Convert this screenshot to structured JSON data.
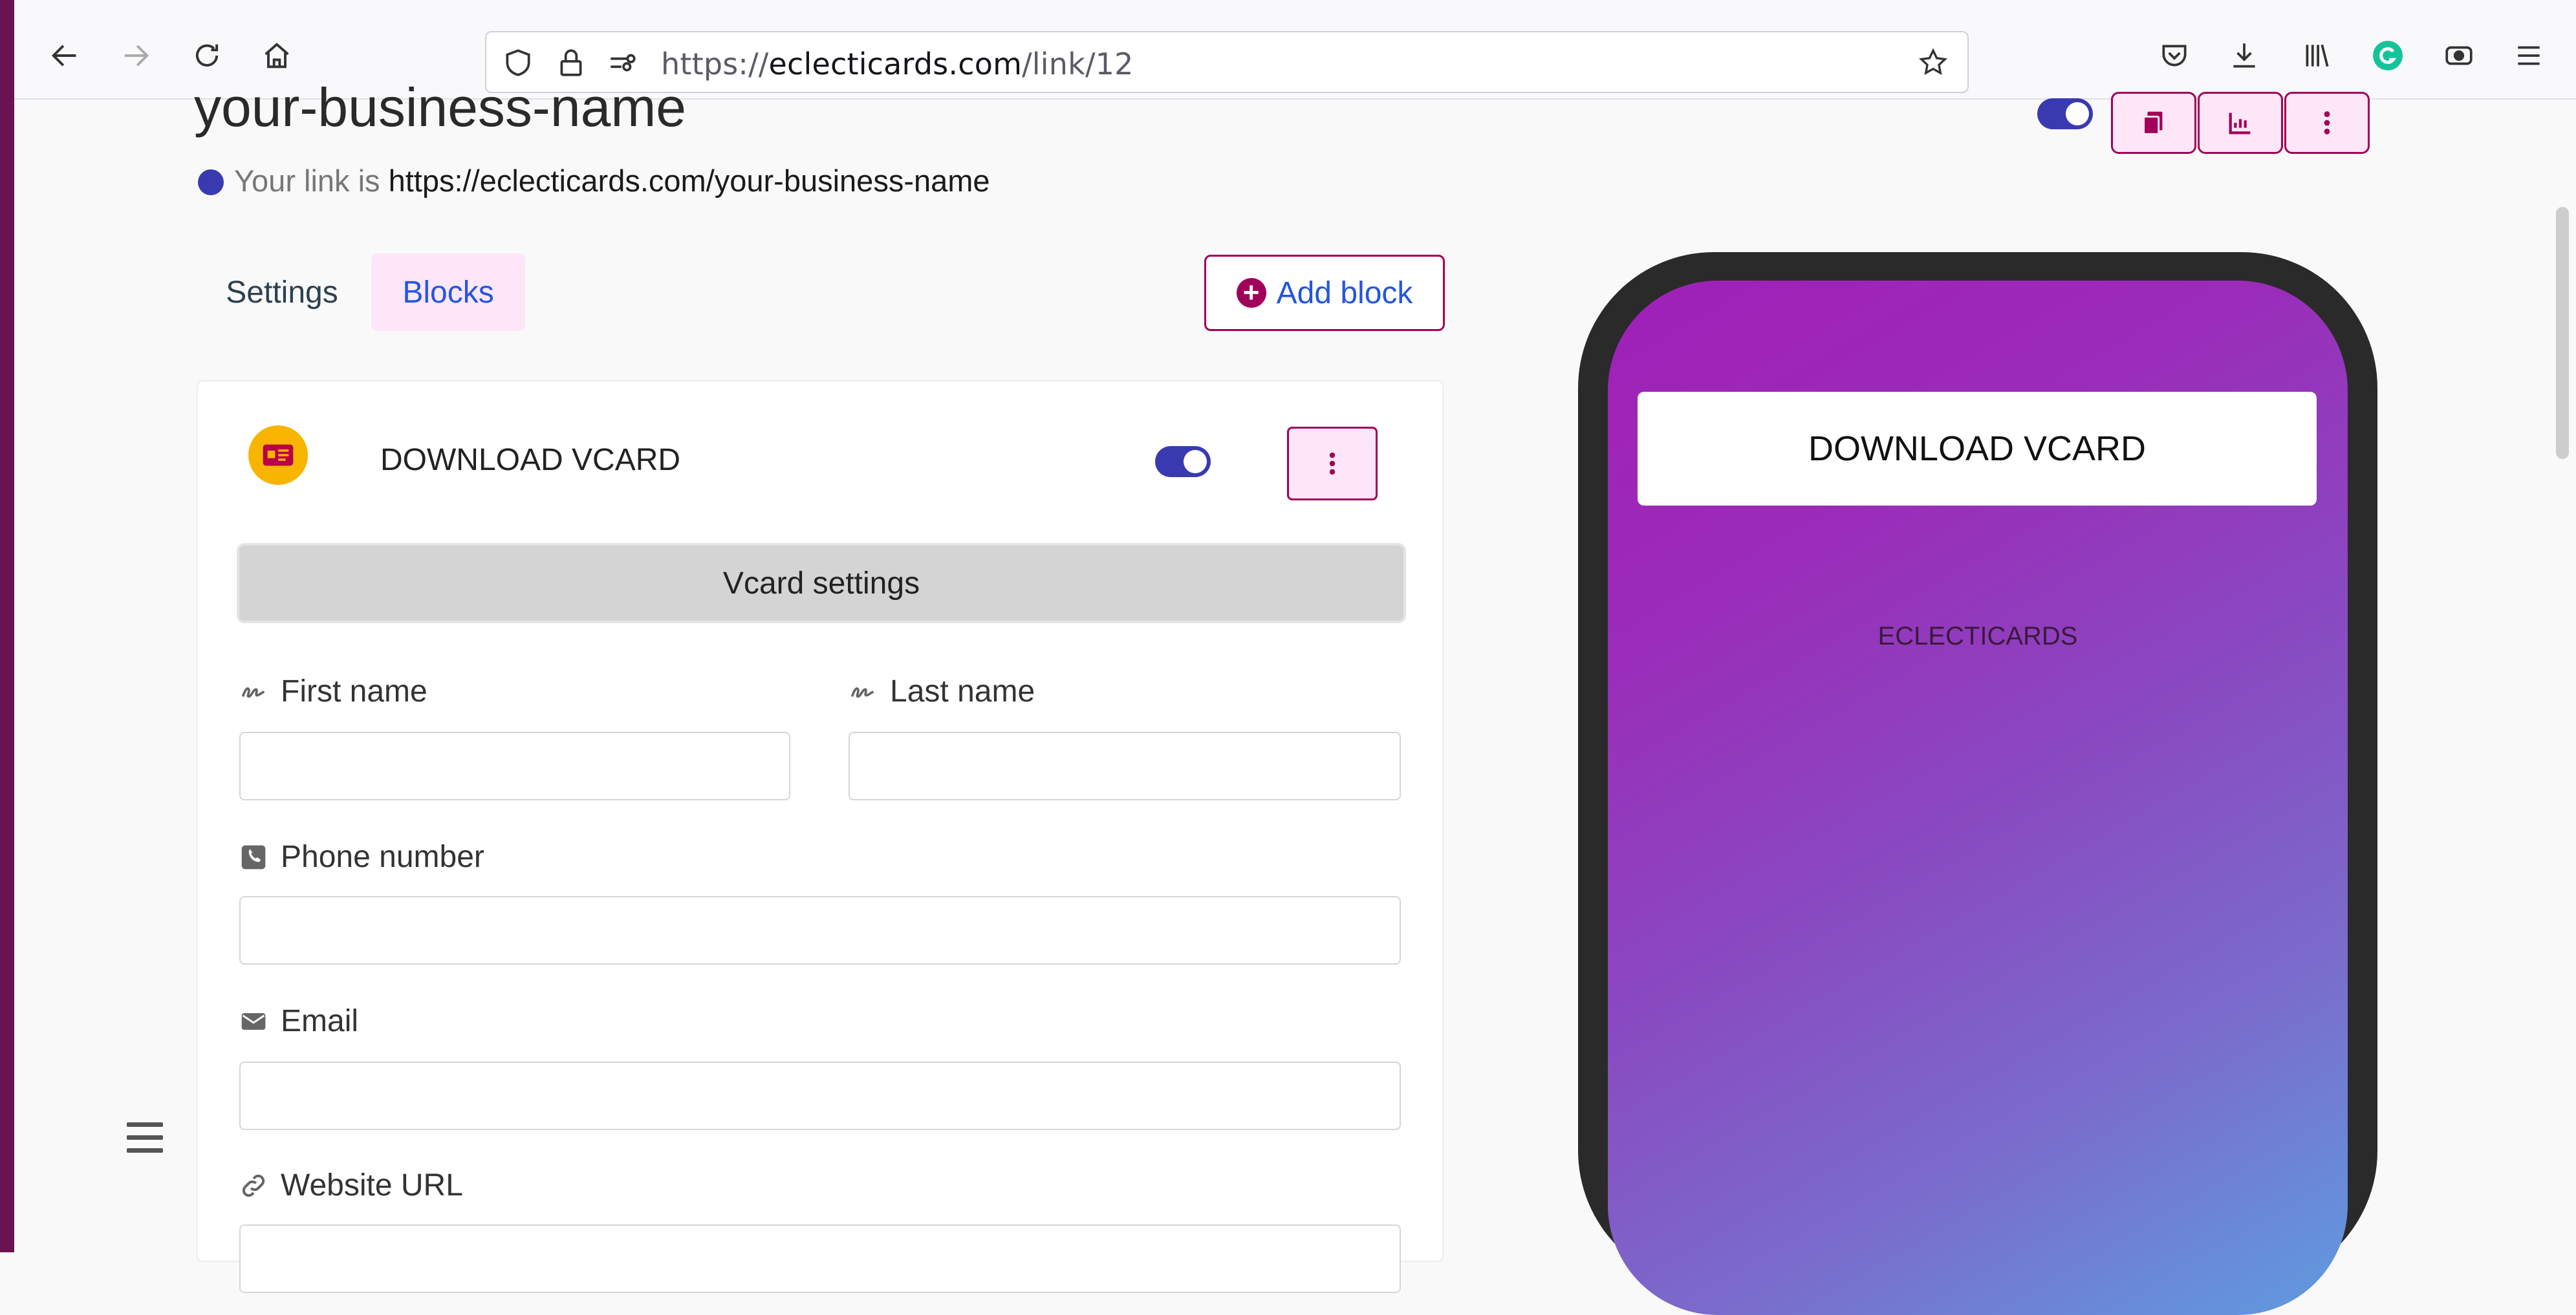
{
  "browser": {
    "url_scheme": "https://",
    "url_host": "eclecticards.com",
    "url_path": "/link/12"
  },
  "header": {
    "title": "your-business-name",
    "link_prefix": "Your link is",
    "link_url": "https://eclecticards.com/your-business-name"
  },
  "tabs": {
    "settings": "Settings",
    "blocks": "Blocks"
  },
  "add_block_label": "Add block",
  "block": {
    "title": "DOWNLOAD VCARD",
    "settings_label": "Vcard settings",
    "fields": {
      "first_name": "First name",
      "last_name": "Last name",
      "phone": "Phone number",
      "email": "Email",
      "website": "Website URL"
    }
  },
  "preview": {
    "button_label": "DOWNLOAD VCARD",
    "brand": "ECLECTICARDS"
  },
  "colors": {
    "accent": "#a0005a",
    "toggle": "#3a3ab0",
    "link": "#2555e0"
  }
}
